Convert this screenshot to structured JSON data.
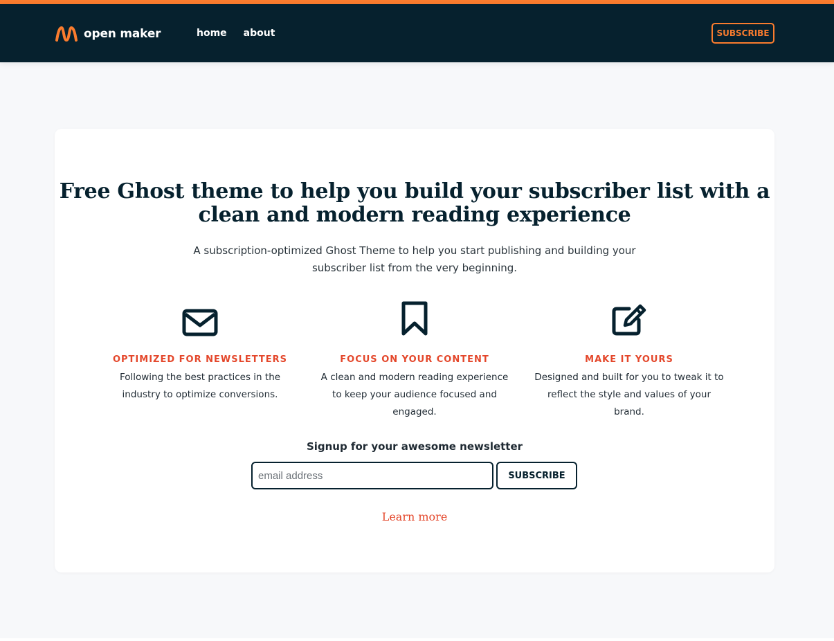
{
  "brand": {
    "name": "open maker",
    "logo_icon": "wave-logo-icon",
    "accent_color": "#fa7c2e",
    "header_bg": "#06212e",
    "highlight_color": "#e4472b"
  },
  "nav": {
    "items": [
      {
        "label": "home"
      },
      {
        "label": "about"
      }
    ],
    "subscribe_label": "SUBSCRIBE"
  },
  "hero": {
    "title": "Free Ghost theme to help you build your subscriber list with a clean and modern reading experience",
    "subtitle": "A subscription-optimized Ghost Theme to help you start publishing and building your subscriber list from the very beginning."
  },
  "features": [
    {
      "icon": "envelope-icon",
      "title": "OPTIMIZED FOR NEWSLETTERS",
      "description": "Following the best practices in the industry to optimize conversions."
    },
    {
      "icon": "bookmark-icon",
      "title": "FOCUS ON YOUR CONTENT",
      "description": "A clean and modern reading experience to keep your audience focused and engaged."
    },
    {
      "icon": "edit-icon",
      "title": "MAKE IT YOURS",
      "description": "Designed and built for you to tweak it to reflect the style and values of your brand."
    }
  ],
  "signup": {
    "label": "Signup for your awesome newsletter",
    "email_placeholder": "email address",
    "email_value": "",
    "button_label": "SUBSCRIBE"
  },
  "learn_more": "Learn more"
}
